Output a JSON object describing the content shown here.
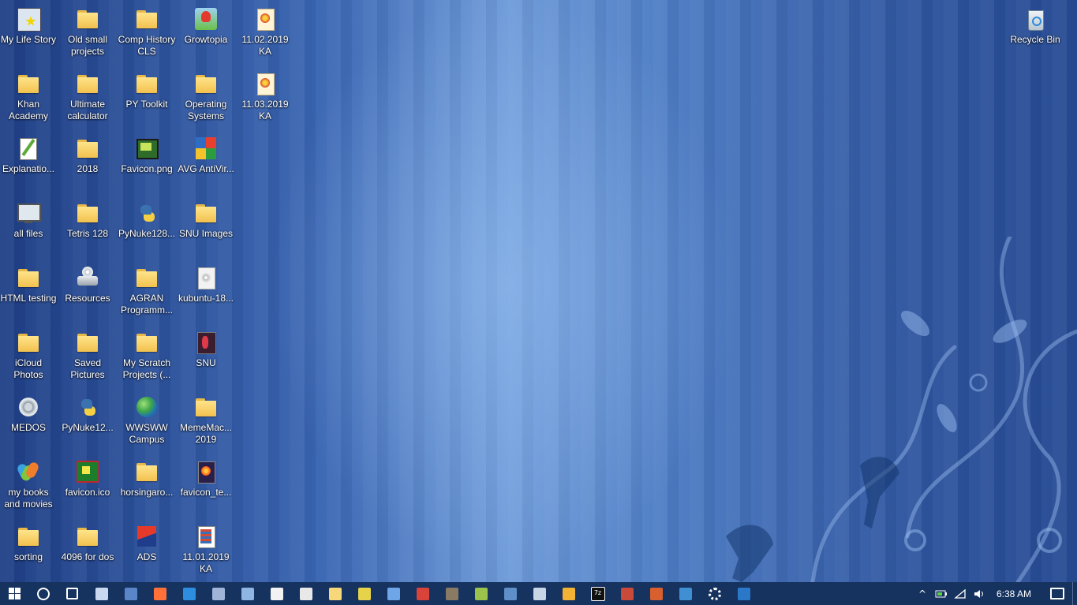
{
  "desktop": {
    "icons": [
      {
        "label": "My Life Story",
        "type": "app-shortcut"
      },
      {
        "label": "Old small projects",
        "type": "folder"
      },
      {
        "label": "Comp History CLS",
        "type": "folder"
      },
      {
        "label": "Growtopia",
        "type": "game"
      },
      {
        "label": "11.02.2019 KA",
        "type": "img-doc"
      },
      {
        "label": "Khan Academy",
        "type": "folder"
      },
      {
        "label": "Ultimate calculator",
        "type": "folder"
      },
      {
        "label": "PY Toolkit",
        "type": "folder"
      },
      {
        "label": "Operating Systems",
        "type": "folder"
      },
      {
        "label": "11.03.2019 KA",
        "type": "img-doc"
      },
      {
        "label": "Explanatio...",
        "type": "notepad"
      },
      {
        "label": "2018",
        "type": "folder"
      },
      {
        "label": "Favicon.png",
        "type": "green-img"
      },
      {
        "label": "AVG AntiVir...",
        "type": "avg"
      },
      {
        "label": "all files",
        "type": "monitor"
      },
      {
        "label": "Tetris 128",
        "type": "folder"
      },
      {
        "label": "PyNuke128...",
        "type": "python"
      },
      {
        "label": "SNU Images",
        "type": "folder"
      },
      {
        "label": "HTML testing",
        "type": "folder"
      },
      {
        "label": "Resources",
        "type": "drive"
      },
      {
        "label": "AGRAN Programm...",
        "type": "folder"
      },
      {
        "label": "kubuntu-18...",
        "type": "disc"
      },
      {
        "label": "iCloud Photos",
        "type": "folder"
      },
      {
        "label": "Saved Pictures",
        "type": "folder"
      },
      {
        "label": "My Scratch Projects (...",
        "type": "folder"
      },
      {
        "label": "SNU",
        "type": "snu"
      },
      {
        "label": "MEDOS",
        "type": "gear"
      },
      {
        "label": "PyNuke12...",
        "type": "python"
      },
      {
        "label": "WWSWW Campus",
        "type": "globe"
      },
      {
        "label": "MemeMac... 2019",
        "type": "folder"
      },
      {
        "label": "my books and movies",
        "type": "msn"
      },
      {
        "label": "favicon.ico",
        "type": "pix-ico"
      },
      {
        "label": "horsingaro...",
        "type": "folder"
      },
      {
        "label": "favicon_te...",
        "type": "firefox-doc"
      },
      {
        "label": "sorting",
        "type": "folder"
      },
      {
        "label": "4096 for dos",
        "type": "folder"
      },
      {
        "label": "ADS",
        "type": "ads"
      },
      {
        "label": "11.01.2019 KA",
        "type": "book"
      }
    ],
    "recycle_bin": {
      "label": "Recycle Bin",
      "type": "recycle"
    }
  },
  "taskbar": {
    "pinned": [
      {
        "name": "search-icon",
        "color": "#ffffff"
      },
      {
        "name": "task-view-icon",
        "color": "#ffffff"
      },
      {
        "name": "this-pc-icon",
        "color": "#c9d8ee"
      },
      {
        "name": "app-icon-1",
        "color": "#5a86c9"
      },
      {
        "name": "firefox-icon",
        "color": "#ff7139"
      },
      {
        "name": "edge-icon",
        "color": "#2d8ee0"
      },
      {
        "name": "app-icon-2",
        "color": "#9fb4d8"
      },
      {
        "name": "network-icon",
        "color": "#8fb5e3"
      },
      {
        "name": "document-icon",
        "color": "#f2f2f2"
      },
      {
        "name": "calculator-icon",
        "color": "#e8e8e8"
      },
      {
        "name": "notepad-icon",
        "color": "#f7d77a"
      },
      {
        "name": "app-icon-3",
        "color": "#e6d34a"
      },
      {
        "name": "photos-icon",
        "color": "#6fa6e8"
      },
      {
        "name": "app-icon-4",
        "color": "#d9433a"
      },
      {
        "name": "gimp-icon",
        "color": "#8b7a63"
      },
      {
        "name": "app-icon-5",
        "color": "#9bc24a"
      },
      {
        "name": "app-icon-6",
        "color": "#5e8fc9"
      },
      {
        "name": "app-icon-7",
        "color": "#c8d5e6"
      },
      {
        "name": "app-icon-8",
        "color": "#f2b233"
      },
      {
        "name": "7zip-icon",
        "color": "#ffffff"
      },
      {
        "name": "app-icon-9",
        "color": "#c94a3a"
      },
      {
        "name": "app-icon-10",
        "color": "#d9602e"
      },
      {
        "name": "app-icon-11",
        "color": "#3f8fd2"
      },
      {
        "name": "settings-icon",
        "color": "#ffffff"
      },
      {
        "name": "app-icon-12",
        "color": "#2b78c8"
      }
    ],
    "seven_zip_text": "7z",
    "tray": {
      "chevron": "^",
      "clock": "6:38 AM"
    }
  }
}
